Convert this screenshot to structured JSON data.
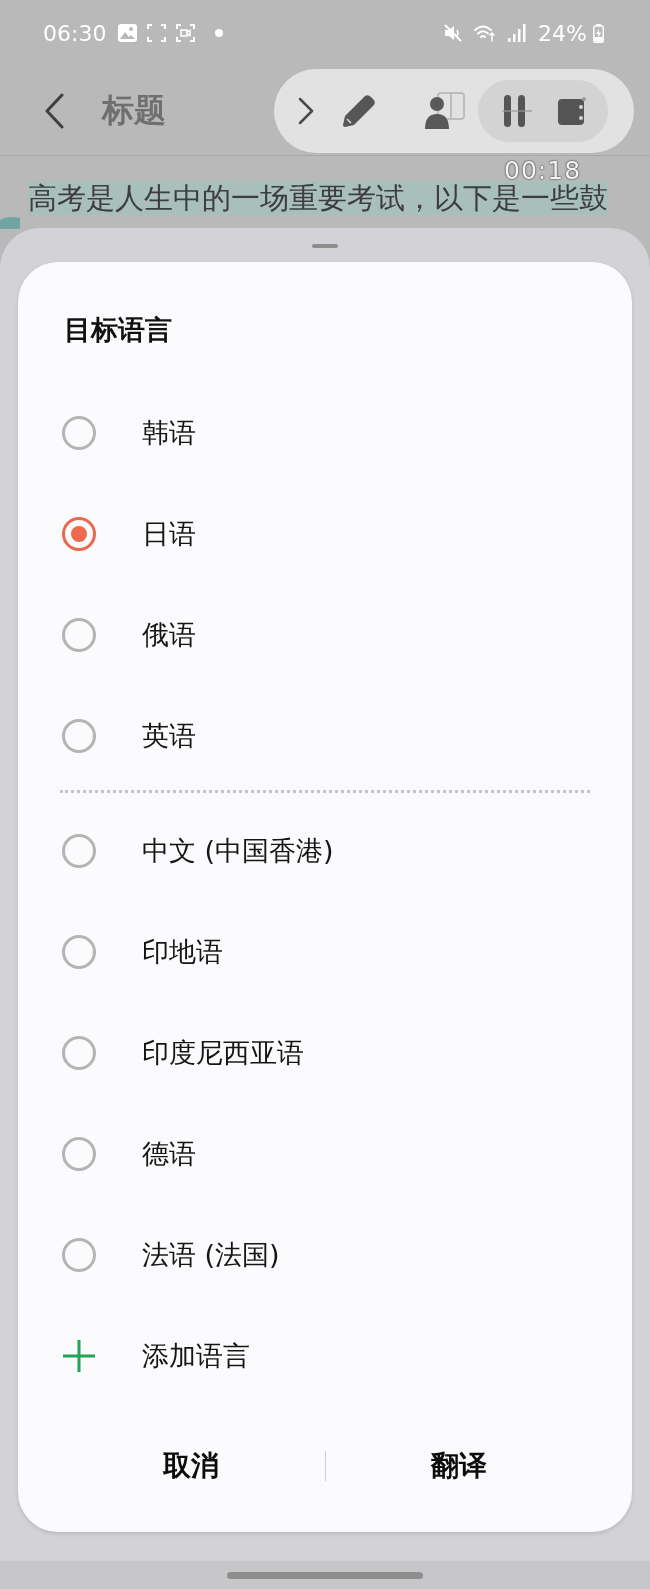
{
  "status_bar": {
    "time": "06:30",
    "battery": "24%"
  },
  "app_bar": {
    "title": "标题"
  },
  "recorder": {
    "timer": "00:18"
  },
  "note": {
    "text": "高考是人生中的一场重要考试，以下是一些鼓"
  },
  "dialog": {
    "title": "目标语言",
    "option_groups": [
      {
        "options": [
          {
            "label": "韩语",
            "selected": false
          },
          {
            "label": "日语",
            "selected": true
          },
          {
            "label": "俄语",
            "selected": false
          },
          {
            "label": "英语",
            "selected": false
          }
        ]
      },
      {
        "options": [
          {
            "label": "中文 (中国香港)",
            "selected": false
          },
          {
            "label": "印地语",
            "selected": false
          },
          {
            "label": "印度尼西亚语",
            "selected": false
          },
          {
            "label": "德语",
            "selected": false
          },
          {
            "label": "法语 (法国)",
            "selected": false
          }
        ]
      }
    ],
    "add_language": {
      "label": "添加语言"
    },
    "buttons": [
      {
        "label": "取消"
      },
      {
        "label": "翻译"
      }
    ]
  }
}
